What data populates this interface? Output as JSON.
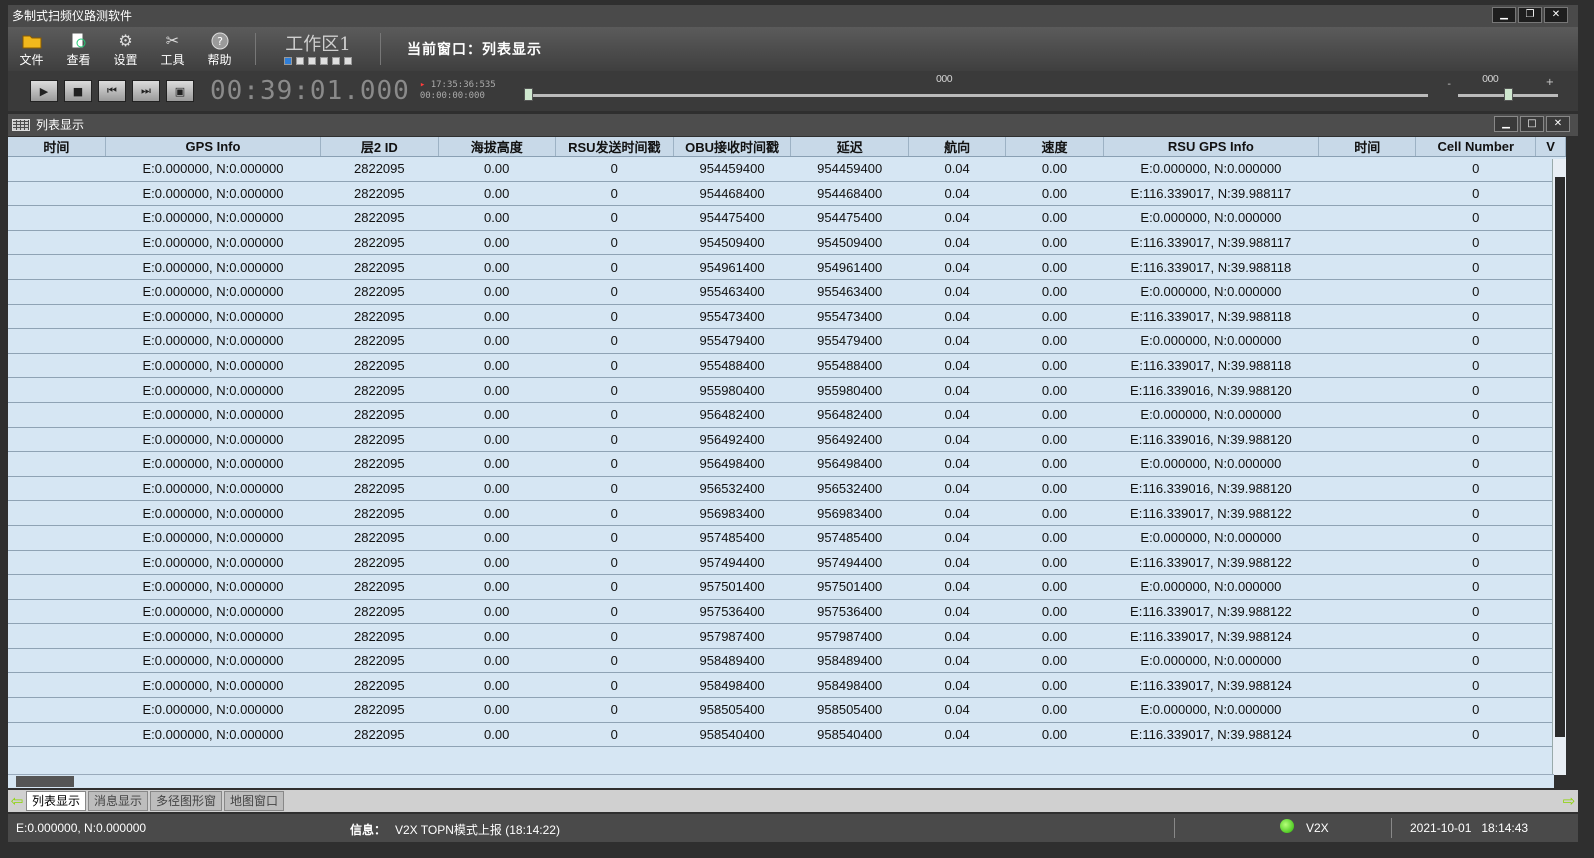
{
  "window": {
    "title": "多制式扫频仪路测软件",
    "minimize": "▁",
    "restore": "❐",
    "close": "✕"
  },
  "toolbar": {
    "items": [
      {
        "label": "文件",
        "icon": "folder-icon"
      },
      {
        "label": "查看",
        "icon": "view-icon"
      },
      {
        "label": "设置",
        "icon": "gear-icon"
      },
      {
        "label": "工具",
        "icon": "tools-icon"
      },
      {
        "label": "帮助",
        "icon": "help-icon"
      }
    ],
    "workspace": "工作区1",
    "current_window": "当前窗口：列表显示"
  },
  "player": {
    "time_big": "00:39:01.000",
    "time_small_top": "17:35:36:535",
    "time_small_bottom": "00:00:00:000",
    "slider_label": "000",
    "zoom_label": "000",
    "zoom_minus": "-",
    "zoom_plus": "+"
  },
  "panel": {
    "title": "列表显示"
  },
  "table": {
    "columns": [
      "时间",
      "GPS Info",
      "层2 ID",
      "海拔高度",
      "RSU发送时间戳",
      "OBU接收时间戳",
      "延迟",
      "航向",
      "速度",
      "RSU GPS Info",
      "时间",
      "Cell Number",
      "V"
    ],
    "rows": [
      [
        "",
        "E:0.000000, N:0.000000",
        "2822095",
        "0.00",
        "0",
        "954459400",
        "954459400",
        "0.04",
        "0.00",
        "E:0.000000, N:0.000000",
        "",
        "0",
        ""
      ],
      [
        "",
        "E:0.000000, N:0.000000",
        "2822095",
        "0.00",
        "0",
        "954468400",
        "954468400",
        "0.04",
        "0.00",
        "E:116.339017, N:39.988117",
        "",
        "0",
        ""
      ],
      [
        "",
        "E:0.000000, N:0.000000",
        "2822095",
        "0.00",
        "0",
        "954475400",
        "954475400",
        "0.04",
        "0.00",
        "E:0.000000, N:0.000000",
        "",
        "0",
        ""
      ],
      [
        "",
        "E:0.000000, N:0.000000",
        "2822095",
        "0.00",
        "0",
        "954509400",
        "954509400",
        "0.04",
        "0.00",
        "E:116.339017, N:39.988117",
        "",
        "0",
        ""
      ],
      [
        "",
        "E:0.000000, N:0.000000",
        "2822095",
        "0.00",
        "0",
        "954961400",
        "954961400",
        "0.04",
        "0.00",
        "E:116.339017, N:39.988118",
        "",
        "0",
        ""
      ],
      [
        "",
        "E:0.000000, N:0.000000",
        "2822095",
        "0.00",
        "0",
        "955463400",
        "955463400",
        "0.04",
        "0.00",
        "E:0.000000, N:0.000000",
        "",
        "0",
        ""
      ],
      [
        "",
        "E:0.000000, N:0.000000",
        "2822095",
        "0.00",
        "0",
        "955473400",
        "955473400",
        "0.04",
        "0.00",
        "E:116.339017, N:39.988118",
        "",
        "0",
        ""
      ],
      [
        "",
        "E:0.000000, N:0.000000",
        "2822095",
        "0.00",
        "0",
        "955479400",
        "955479400",
        "0.04",
        "0.00",
        "E:0.000000, N:0.000000",
        "",
        "0",
        ""
      ],
      [
        "",
        "E:0.000000, N:0.000000",
        "2822095",
        "0.00",
        "0",
        "955488400",
        "955488400",
        "0.04",
        "0.00",
        "E:116.339017, N:39.988118",
        "",
        "0",
        ""
      ],
      [
        "",
        "E:0.000000, N:0.000000",
        "2822095",
        "0.00",
        "0",
        "955980400",
        "955980400",
        "0.04",
        "0.00",
        "E:116.339016, N:39.988120",
        "",
        "0",
        ""
      ],
      [
        "",
        "E:0.000000, N:0.000000",
        "2822095",
        "0.00",
        "0",
        "956482400",
        "956482400",
        "0.04",
        "0.00",
        "E:0.000000, N:0.000000",
        "",
        "0",
        ""
      ],
      [
        "",
        "E:0.000000, N:0.000000",
        "2822095",
        "0.00",
        "0",
        "956492400",
        "956492400",
        "0.04",
        "0.00",
        "E:116.339016, N:39.988120",
        "",
        "0",
        ""
      ],
      [
        "",
        "E:0.000000, N:0.000000",
        "2822095",
        "0.00",
        "0",
        "956498400",
        "956498400",
        "0.04",
        "0.00",
        "E:0.000000, N:0.000000",
        "",
        "0",
        ""
      ],
      [
        "",
        "E:0.000000, N:0.000000",
        "2822095",
        "0.00",
        "0",
        "956532400",
        "956532400",
        "0.04",
        "0.00",
        "E:116.339016, N:39.988120",
        "",
        "0",
        ""
      ],
      [
        "",
        "E:0.000000, N:0.000000",
        "2822095",
        "0.00",
        "0",
        "956983400",
        "956983400",
        "0.04",
        "0.00",
        "E:116.339017, N:39.988122",
        "",
        "0",
        ""
      ],
      [
        "",
        "E:0.000000, N:0.000000",
        "2822095",
        "0.00",
        "0",
        "957485400",
        "957485400",
        "0.04",
        "0.00",
        "E:0.000000, N:0.000000",
        "",
        "0",
        ""
      ],
      [
        "",
        "E:0.000000, N:0.000000",
        "2822095",
        "0.00",
        "0",
        "957494400",
        "957494400",
        "0.04",
        "0.00",
        "E:116.339017, N:39.988122",
        "",
        "0",
        ""
      ],
      [
        "",
        "E:0.000000, N:0.000000",
        "2822095",
        "0.00",
        "0",
        "957501400",
        "957501400",
        "0.04",
        "0.00",
        "E:0.000000, N:0.000000",
        "",
        "0",
        ""
      ],
      [
        "",
        "E:0.000000, N:0.000000",
        "2822095",
        "0.00",
        "0",
        "957536400",
        "957536400",
        "0.04",
        "0.00",
        "E:116.339017, N:39.988122",
        "",
        "0",
        ""
      ],
      [
        "",
        "E:0.000000, N:0.000000",
        "2822095",
        "0.00",
        "0",
        "957987400",
        "957987400",
        "0.04",
        "0.00",
        "E:116.339017, N:39.988124",
        "",
        "0",
        ""
      ],
      [
        "",
        "E:0.000000, N:0.000000",
        "2822095",
        "0.00",
        "0",
        "958489400",
        "958489400",
        "0.04",
        "0.00",
        "E:0.000000, N:0.000000",
        "",
        "0",
        ""
      ],
      [
        "",
        "E:0.000000, N:0.000000",
        "2822095",
        "0.00",
        "0",
        "958498400",
        "958498400",
        "0.04",
        "0.00",
        "E:116.339017, N:39.988124",
        "",
        "0",
        ""
      ],
      [
        "",
        "E:0.000000, N:0.000000",
        "2822095",
        "0.00",
        "0",
        "958505400",
        "958505400",
        "0.04",
        "0.00",
        "E:0.000000, N:0.000000",
        "",
        "0",
        ""
      ],
      [
        "",
        "E:0.000000, N:0.000000",
        "2822095",
        "0.00",
        "0",
        "958540400",
        "958540400",
        "0.04",
        "0.00",
        "E:116.339017, N:39.988124",
        "",
        "0",
        ""
      ]
    ]
  },
  "tabs": [
    {
      "label": "列表显示",
      "active": true
    },
    {
      "label": "消息显示",
      "active": false
    },
    {
      "label": "多径图形窗",
      "active": false
    },
    {
      "label": "地图窗口",
      "active": false
    }
  ],
  "status": {
    "coords": "E:0.000000, N:0.000000",
    "info_label": "信息：",
    "info_text": "V2X TOPN模式上报 (18:14:22)",
    "mode": "V2X",
    "datetime": "2021-10-01   18:14:43",
    "led_color": "#25b500"
  }
}
